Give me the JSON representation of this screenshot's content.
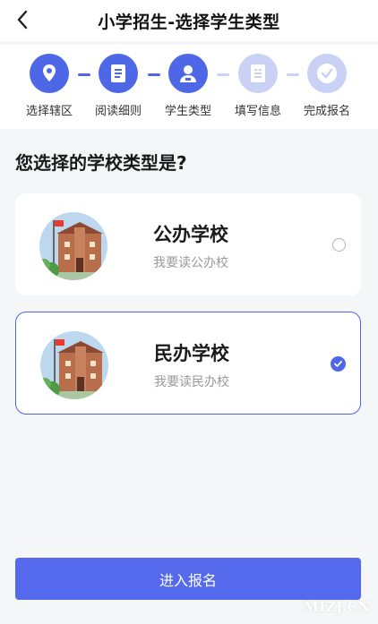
{
  "header": {
    "title": "小学招生-选择学生类型",
    "back_icon": "chevron-left-icon"
  },
  "steps": [
    {
      "label": "选择辖区",
      "icon": "map-pin-icon",
      "state": "active"
    },
    {
      "label": "阅读细则",
      "icon": "document-icon",
      "state": "active"
    },
    {
      "label": "学生类型",
      "icon": "student-icon",
      "state": "active"
    },
    {
      "label": "填写信息",
      "icon": "form-icon",
      "state": "inactive"
    },
    {
      "label": "完成报名",
      "icon": "check-circle-icon",
      "state": "inactive"
    }
  ],
  "question": "您选择的学校类型是?",
  "options": [
    {
      "title": "公办学校",
      "subtitle": "我要读公办校",
      "selected": false,
      "icon": "school-building-icon"
    },
    {
      "title": "民办学校",
      "subtitle": "我要读民办校",
      "selected": true,
      "icon": "school-building-icon"
    }
  ],
  "submit_label": "进入报名",
  "watermark": "MIZJ.CN",
  "colors": {
    "accent": "#4d67e6",
    "accent_light": "#c9d2f4",
    "button": "#5469ec",
    "background": "#f5f6f8"
  }
}
